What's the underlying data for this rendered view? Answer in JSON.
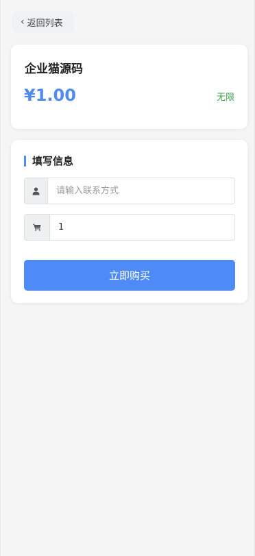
{
  "nav": {
    "back_label": "返回列表"
  },
  "product": {
    "name": "企业猫源码",
    "price": "¥1.00",
    "stock": "无限"
  },
  "form": {
    "section_title": "填写信息",
    "contact": {
      "placeholder": "请输入联系方式",
      "value": ""
    },
    "quantity": {
      "value": "1"
    },
    "buy_label": "立即购买"
  },
  "colors": {
    "accent": "#4f8cf0",
    "button": "#4f8bf7",
    "stock_green": "#3fa34d",
    "background": "#f5f5f6"
  },
  "icons": {
    "back": "chevron-left-icon",
    "contact": "user-icon",
    "quantity": "cart-icon"
  }
}
